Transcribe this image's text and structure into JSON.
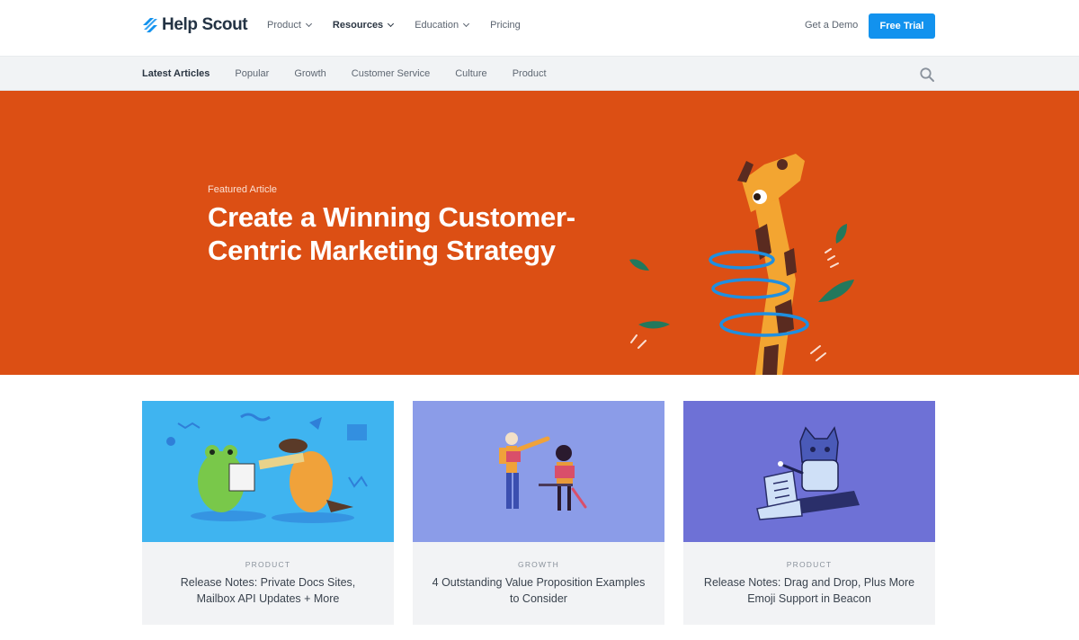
{
  "brand": {
    "name": "Help Scout",
    "accent": "#1292ee",
    "hero_bg": "#dc4f14"
  },
  "nav": {
    "items": [
      {
        "label": "Product",
        "dropdown": true,
        "active": false
      },
      {
        "label": "Resources",
        "dropdown": true,
        "active": true
      },
      {
        "label": "Education",
        "dropdown": true,
        "active": false
      },
      {
        "label": "Pricing",
        "dropdown": false,
        "active": false
      }
    ],
    "demo_label": "Get a Demo",
    "trial_label": "Free Trial"
  },
  "subnav": {
    "items": [
      "Latest Articles",
      "Popular",
      "Growth",
      "Customer Service",
      "Culture",
      "Product"
    ],
    "active_index": 0,
    "search_icon": "search-icon"
  },
  "hero": {
    "kicker": "Featured Article",
    "title": "Create a Winning Customer-Centric Marketing Strategy"
  },
  "cards": [
    {
      "category": "PRODUCT",
      "title": "Release Notes: Private Docs Sites, Mailbox API Updates + More",
      "color": "#3fb4f0"
    },
    {
      "category": "GROWTH",
      "title": "4 Outstanding Value Proposition Examples to Consider",
      "color": "#8b9ce8"
    },
    {
      "category": "PRODUCT",
      "title": "Release Notes: Drag and Drop, Plus More Emoji Support in Beacon",
      "color": "#6e71d6"
    }
  ]
}
